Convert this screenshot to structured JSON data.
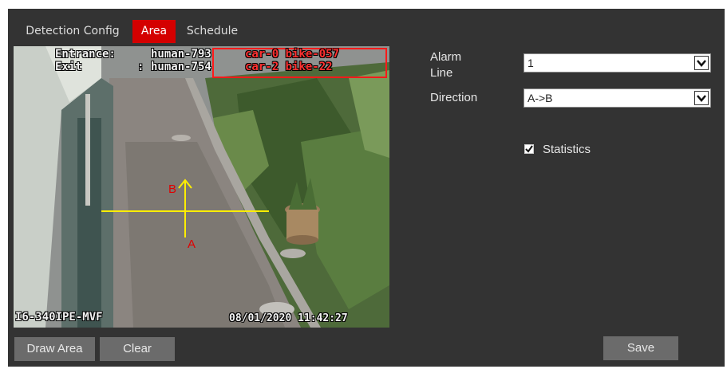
{
  "tabs": [
    {
      "label": "Detection Config"
    },
    {
      "label": "Area"
    },
    {
      "label": "Schedule"
    }
  ],
  "video": {
    "entrance_label": "Entrance:",
    "exit_label": "Exit",
    "exit_colon": ":",
    "entrance_human": "human-793",
    "exit_human": "human-754",
    "entrance_counts": "car-0 bike-057",
    "exit_counts": "car-2 bike-22",
    "camera_name": "I6-340IPE-MVF",
    "timestamp": "08/01/2020 11:42:27",
    "line_label_a": "A",
    "line_label_b": "B"
  },
  "form": {
    "alarm_line_label_1": "Alarm",
    "alarm_line_label_2": "Line",
    "alarm_line_value": "1",
    "direction_label": "Direction",
    "direction_value": "A->B",
    "statistics_label": "Statistics",
    "statistics_checked": true
  },
  "buttons": {
    "draw_area": "Draw Area",
    "clear": "Clear",
    "save": "Save"
  },
  "colors": {
    "active_tab": "#d40000",
    "panel_bg": "#333333",
    "button_bg": "#6b6b6b",
    "count_box": "#ff1a1a",
    "tripwire": "#ffee00"
  }
}
